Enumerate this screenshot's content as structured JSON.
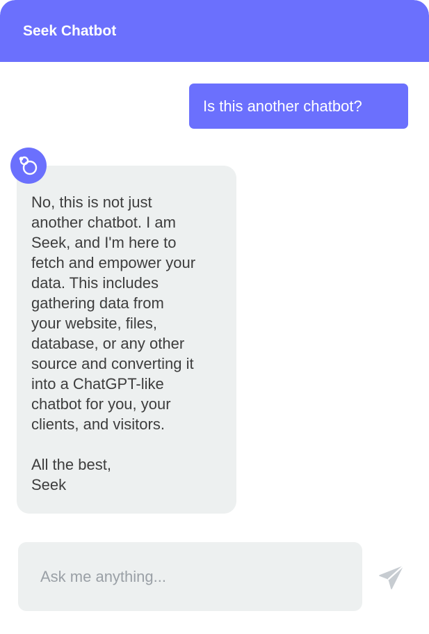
{
  "header": {
    "title": "Seek Chatbot"
  },
  "messages": {
    "user": {
      "text": "Is this another chatbot?"
    },
    "bot": {
      "avatar_icon": "seek-logo-icon",
      "lines": [
        "No, this is not just",
        "another chatbot. I am",
        "Seek, and I'm here to",
        "fetch and empower your",
        "data. This includes",
        "gathering data from",
        "your website, files,",
        "database, or any other",
        "source and converting it",
        "into a ChatGPT-like",
        "chatbot for you, your",
        "clients, and visitors."
      ],
      "signoff": [
        "All the best,",
        "Seek"
      ]
    }
  },
  "composer": {
    "placeholder": "Ask me anything...",
    "value": "",
    "send_icon": "send-icon"
  },
  "colors": {
    "accent": "#6b70fd",
    "bubble_gray": "#edf0f0",
    "text_dark": "#3d3d3d",
    "placeholder": "#9aa0a6",
    "send_icon": "#c7ccd1"
  }
}
